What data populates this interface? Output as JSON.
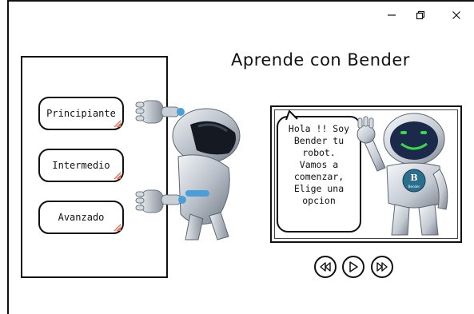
{
  "window": {
    "controls": {
      "minimize": "minimize-icon",
      "maximize": "restore-icon",
      "close": "close-icon"
    }
  },
  "header": {
    "title": "Aprende con Bender"
  },
  "levels": [
    {
      "label": "Principiante"
    },
    {
      "label": "Intermedio"
    },
    {
      "label": "Avanzado"
    }
  ],
  "video": {
    "speech": "Hola !! Soy\nBender tu\nrobot.\nVamos a\ncomenzar,\nElige una\nopcion",
    "badge_letter": "B",
    "badge_text": "Bender"
  },
  "media_controls": [
    "rewind-icon",
    "play-icon",
    "fast-forward-icon"
  ],
  "colors": {
    "accent_corner": "#e8745a",
    "robot_visor": "#1b2a4a",
    "robot_smile": "#3cd64a",
    "badge": "#2a6f8e"
  }
}
